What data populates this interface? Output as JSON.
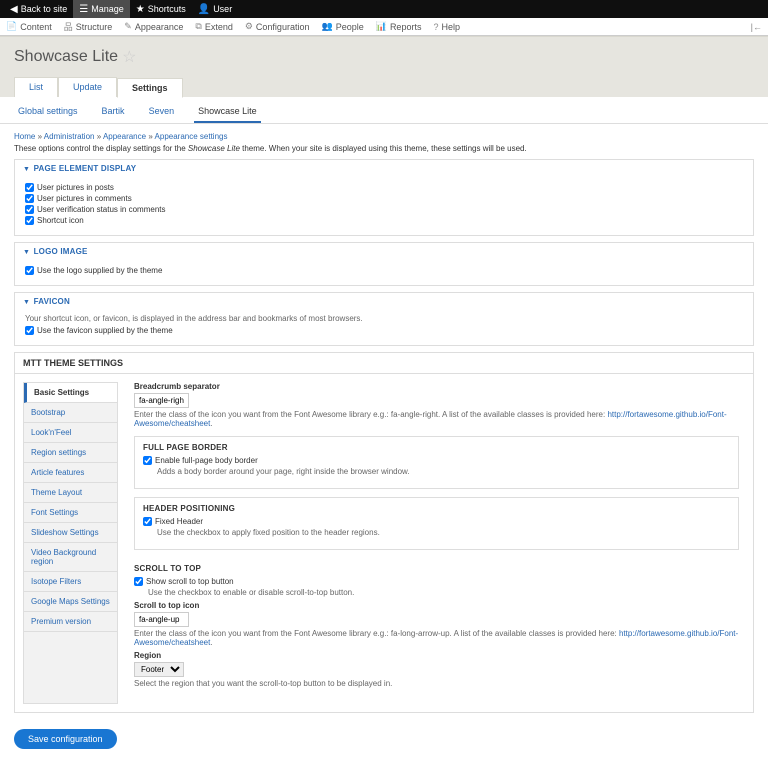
{
  "topbar": {
    "back": "Back to site",
    "manage": "Manage",
    "shortcuts": "Shortcuts",
    "user": "User"
  },
  "adminbar": {
    "content": "Content",
    "structure": "Structure",
    "appearance": "Appearance",
    "extend": "Extend",
    "configuration": "Configuration",
    "people": "People",
    "reports": "Reports",
    "help": "Help"
  },
  "page_title": "Showcase Lite",
  "tabs_primary": {
    "list": "List",
    "update": "Update",
    "settings": "Settings"
  },
  "subtabs": {
    "global": "Global settings",
    "bartik": "Bartik",
    "seven": "Seven",
    "showcase": "Showcase Lite"
  },
  "breadcrumb": {
    "home": "Home",
    "admin": "Administration",
    "appearance": "Appearance",
    "appset": "Appearance settings",
    "sep": " » "
  },
  "help_pre": "These options control the display settings for the ",
  "help_theme": "Showcase Lite",
  "help_post": " theme. When your site is displayed using this theme, these settings will be used.",
  "panel1": {
    "title": "PAGE ELEMENT DISPLAY",
    "o1": "User pictures in posts",
    "o2": "User pictures in comments",
    "o3": "User verification status in comments",
    "o4": "Shortcut icon"
  },
  "panel2": {
    "title": "LOGO IMAGE",
    "o1": "Use the logo supplied by the theme"
  },
  "panel3": {
    "title": "FAVICON",
    "desc": "Your shortcut icon, or favicon, is displayed in the address bar and bookmarks of most browsers.",
    "o1": "Use the favicon supplied by the theme"
  },
  "mtt": {
    "title": "MTT THEME SETTINGS",
    "vtabs": [
      "Basic Settings",
      "Bootstrap",
      "Look'n'Feel",
      "Region settings",
      "Article features",
      "Theme Layout",
      "Font Settings",
      "Slideshow Settings",
      "Video Background region",
      "Isotope Filters",
      "Google Maps Settings",
      "Premium version"
    ]
  },
  "right": {
    "bc_label": "Breadcrumb separator",
    "bc_value": "fa-angle-right",
    "bc_hint_pre": "Enter the class of the icon you want from the Font Awesome library e.g.: fa-angle-right. A list of the available classes is provided here: ",
    "bc_link": "http://fortawesome.github.io/Font-Awesome/cheatsheet",
    "fp_title": "FULL PAGE BORDER",
    "fp_chk": "Enable full-page body border",
    "fp_desc": "Adds a body border around your page, right inside the browser window.",
    "hp_title": "HEADER POSITIONING",
    "hp_chk": "Fixed Header",
    "hp_desc": "Use the checkbox to apply fixed position to the header regions.",
    "st_title": "SCROLL TO TOP",
    "st_chk": "Show scroll to top button",
    "st_desc": "Use the checkbox to enable or disable scroll-to-top button.",
    "st_icon_label": "Scroll to top icon",
    "st_icon_val": "fa-angle-up",
    "st_hint_pre": "Enter the class of the icon you want from the Font Awesome library e.g.: fa-long-arrow-up. A list of the available classes is provided here: ",
    "st_link": "http://fortawesome.github.io/Font-Awesome/cheatsheet",
    "region_label": "Region",
    "region_val": "Footer",
    "region_desc": "Select the region that you want the scroll-to-top button to be displayed in."
  },
  "save": "Save configuration"
}
